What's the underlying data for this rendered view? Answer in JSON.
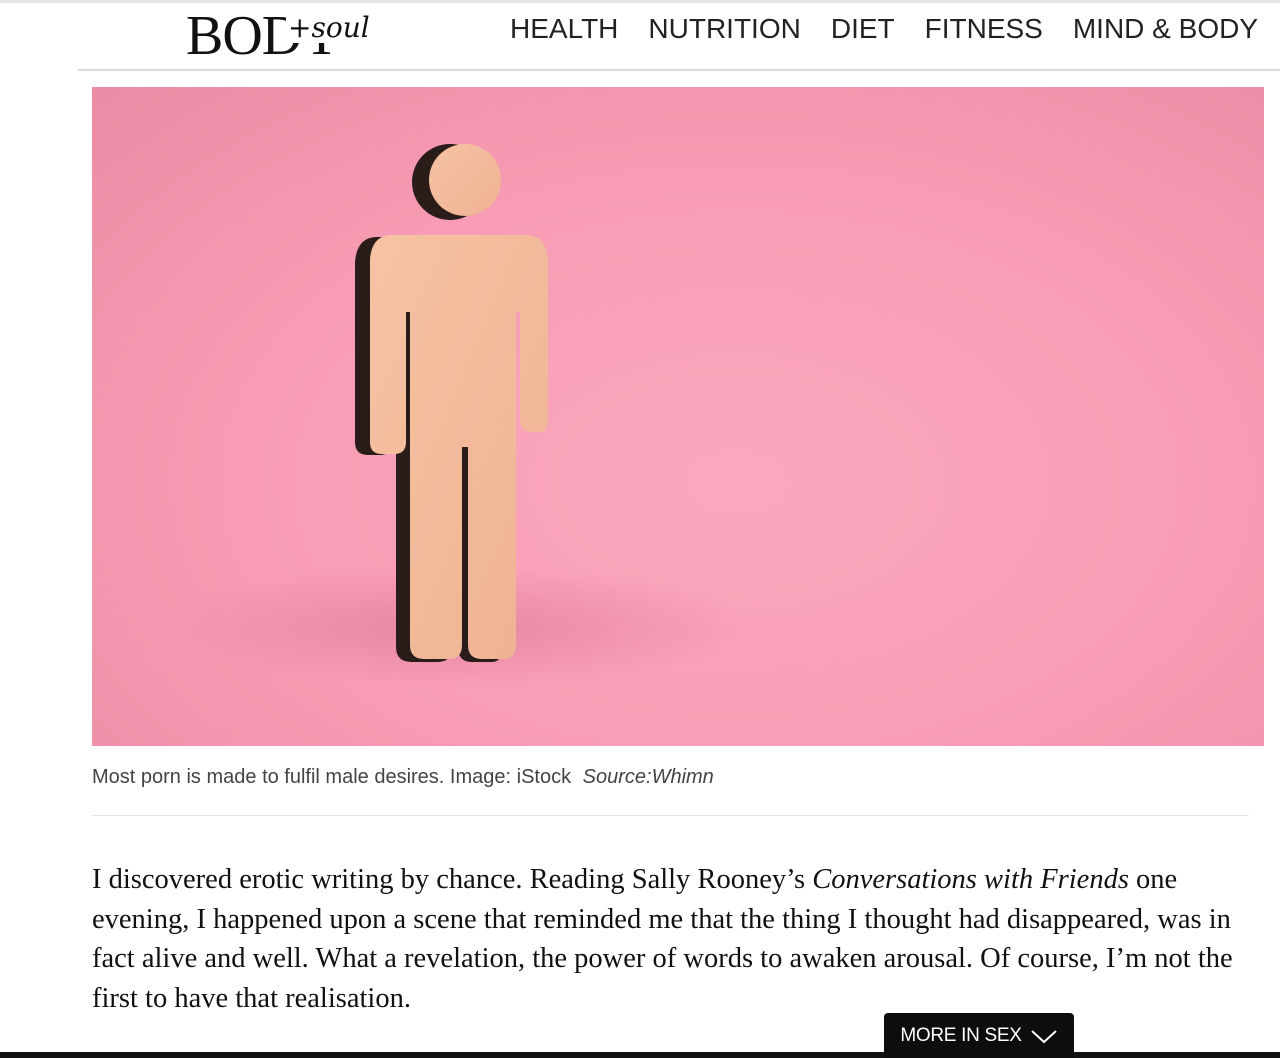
{
  "header": {
    "logo_main": "BODY",
    "logo_sub": "+soul",
    "nav": [
      "HEALTH",
      "NUTRITION",
      "DIET",
      "FITNESS",
      "MIND & BODY"
    ]
  },
  "hero": {
    "icon": "wooden-male-figure",
    "background_color": "#f79cb4"
  },
  "caption": {
    "text": "Most porn is made to fulfil male desires. Image: iStock",
    "source": "Source:Whimn"
  },
  "article": {
    "before_title": "I discovered erotic writing by chance. Reading Sally Rooney’s ",
    "book_title": "Conversations with Friends",
    "after_title": " one evening, I happened upon a scene that reminded me that the thing I thought had disappeared, was in fact alive and well. What a revelation, the power of words to awaken arousal. Of course, I’m not the first to have that realisation."
  },
  "more_button": {
    "label": "MORE IN SEX",
    "icon": "chevron-down-icon"
  }
}
